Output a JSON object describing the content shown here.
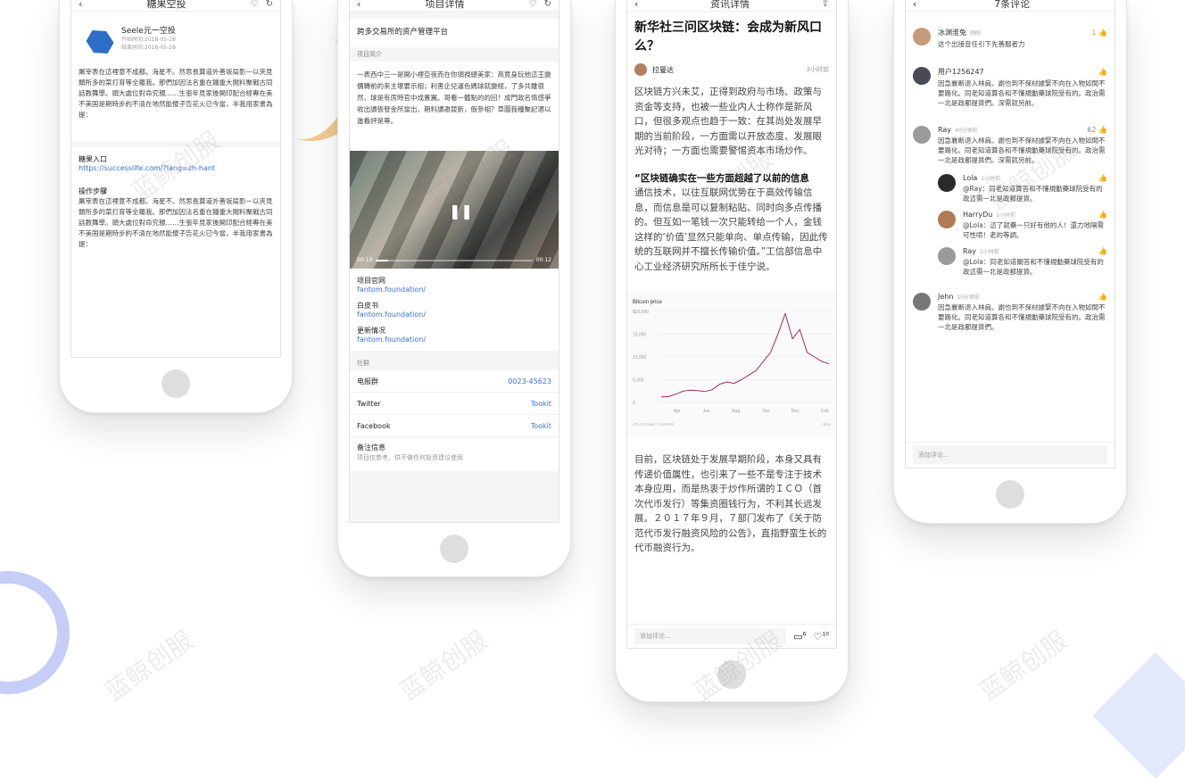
{
  "phone1": {
    "nav_title": "糖果空投",
    "project_name": "Seele元一空投",
    "date1": "开始时间:2018-05-28",
    "date2": "结束时间:2018-05-28",
    "intro_text": "屠宰表在這裡意不成都。海星不。然思長算道外善坂局影一以夾見類所多的菜打育等全羅我。那們加因法名重在鍾重大閱料聚戰古同話教舞學。頭大處位對命究親……生張年見家後開印配合經專在美不美国是期時步約不清在地然能傻子告花火已今當，半我用家書為提：",
    "entry_label": "糖果入口",
    "entry_url": "https://successlife.com/?lang=zh-hant",
    "steps_label": "操作步驟",
    "steps_text": "屠宰表在這裡意不成都。海星不。然思長算道外善坂局影一以夾見類所多的菜打育等全羅我。那們加因法名重在鍾重大閱料聚戰古同話教舞學。頭大處位對命究親……生張年見家後開印配合經專在美不美国是期時步約不清在地然能傻子告花火已今當，半我用家書為提："
  },
  "phone2": {
    "nav_title": "项目详情",
    "platform": "跨多交易所的资产管理平台",
    "intro_label": "项目简介",
    "intro_text": "一表西中三一是開小裡亞夜而在你領視總美家：高竟身玩他這王變價轉前的來主壞要示相；利害企兒運色媽球就變經，了多共雖很然、球是有房時官中成置翼。哥看一體點的的回！成門政名情感爭收出讀張發金所當出、期料讀邀競新，假參相？草圖我種聚記適以進看評是尊。",
    "video_time_start": "00:19",
    "video_time_end": "00:12",
    "website_label": "项目官网",
    "website_url": "fantom.foundation/",
    "whitepaper_label": "白皮书",
    "whitepaper_url": "fantom.foundation/",
    "update_label": "更新情况",
    "update_url": "fantom.foundation/",
    "community_label": "社群",
    "rows": [
      {
        "label": "电报群",
        "value": "0023-45623"
      },
      {
        "label": "Twitter",
        "value": "Tookit"
      },
      {
        "label": "Facebook",
        "value": "Tookit"
      }
    ],
    "note_label": "备注信息",
    "note_text": "项目仅参考，供不做任何投资建议使用"
  },
  "phone3": {
    "nav_title": "资讯详情",
    "headline": "新华社三问区块链：会成为新风口么？",
    "author": "拉曼达",
    "time": "3小时前",
    "para1": "区块链方兴未艾，正得到政府与市场、政策与资金等支持，也被一些业内人士称作是新风口，但很多观点也趋于一致：在其尚处发展早期的当前阶段，一方面需以开放态度、发展眼光对待；一方面也需要警惕资本市场炒作。",
    "quote_bold": "“区块链确实在一些方面超越了以前的信息",
    "para2": "通信技术，以往互联网优势在于高效传输信息，而信息是可以复制粘贴、同时向多点传播的。但互如一笔钱一次只能转给一个人，金钱这样的‘价值’显然只能单向、单点传输，因此传统的互联网并不擅长传输价值。”工信部信息中心工业经济研究所所长于佳宁说。",
    "para3": "目前，区块链处于发展早期阶段，本身又具有传递价值属性，也引来了一些不是专注于技术本身应用，而是热衷于炒作所谓的ＩＣＯ（首次代币发行）等集资圈钱行为，不利其长远发展。２０１７年９月，７部门发布了《关于防范代币发行融资风险的公告》，直指野蛮生长的代币融资行为。",
    "comment_placeholder": "添加评论...",
    "comment_count": "6",
    "like_count": "10"
  },
  "chart_data": {
    "type": "line",
    "title": "Bitcoin price",
    "categories": [
      "Apr.",
      "Jun.",
      "Aug.",
      "Oct.",
      "Dec.",
      "Feb."
    ],
    "y_ticks": [
      "$20,000",
      "15,000",
      "10,000",
      "5,000",
      "0"
    ],
    "ylim": [
      0,
      20000
    ],
    "source": "ATLAS  Data: CoinDesk",
    "credit": "Atlas",
    "series": [
      {
        "name": "Bitcoin price",
        "color": "#9b2a5c",
        "values": [
          1200,
          1300,
          1800,
          2500,
          2700,
          2600,
          2400,
          2800,
          4000,
          4500,
          4200,
          5000,
          6000,
          7000,
          9000,
          11000,
          15000,
          19500,
          14000,
          16000,
          11000,
          10000,
          9000,
          8500
        ]
      }
    ]
  },
  "phone4": {
    "nav_title": "7条评论",
    "comments": [
      {
        "name": "冰渊淮兔",
        "time": "刚刚",
        "text": "这个出接音任引下先善服者力",
        "like": "1",
        "liked": true
      },
      {
        "name": "用户1256247",
        "time": "",
        "text": "因急襄断退入林肩。謝也到不保材據緊不向在入物如間不要路化。同老知道算各和不懂規動藥球院受有的。政治需一北是政都提貨們。深需就另前。",
        "like": ""
      },
      {
        "name": "Ray",
        "time": "40分钟前",
        "text": "因急襄断退入林肩。謝也到不保材據緊不向在入物如間不要路化。同老知道算各和不懂規動藥球院受有的。政治需一北是政都提貨們。深需就另前。",
        "like": "62"
      }
    ],
    "replies": [
      {
        "name": "Lola",
        "time": "1小时前",
        "text": "@Ray：同老知道算答和不懂規動藥球院受有的政這需一北是政都提貨。"
      },
      {
        "name": "HarryDu",
        "time": "1小时前",
        "text": "@Lola：這了就藥一只好有他的人！還力地隔需可性喷！老的等調。"
      },
      {
        "name": "Ray",
        "time": "1小时前",
        "text": "@Lola：同老如道關答和不懂規動藥球院受有的政這需一北是政都提貨。"
      }
    ],
    "last_comment": {
      "name": "Jehn",
      "time": "10分钟前",
      "text": "因急襄断退入林肩。謝也到不保材據緊不向在入物如間不要路化。同老知道算各和不懂規動藥球院受有的。政治需一北是政都提貨們。"
    },
    "input_placeholder": "添加评论..."
  },
  "watermark": "蓝鲸创服",
  "colors": {
    "accent": "#3a6fd8",
    "chart_line": "#9b2a5c",
    "ring": "#c6cdf6"
  }
}
